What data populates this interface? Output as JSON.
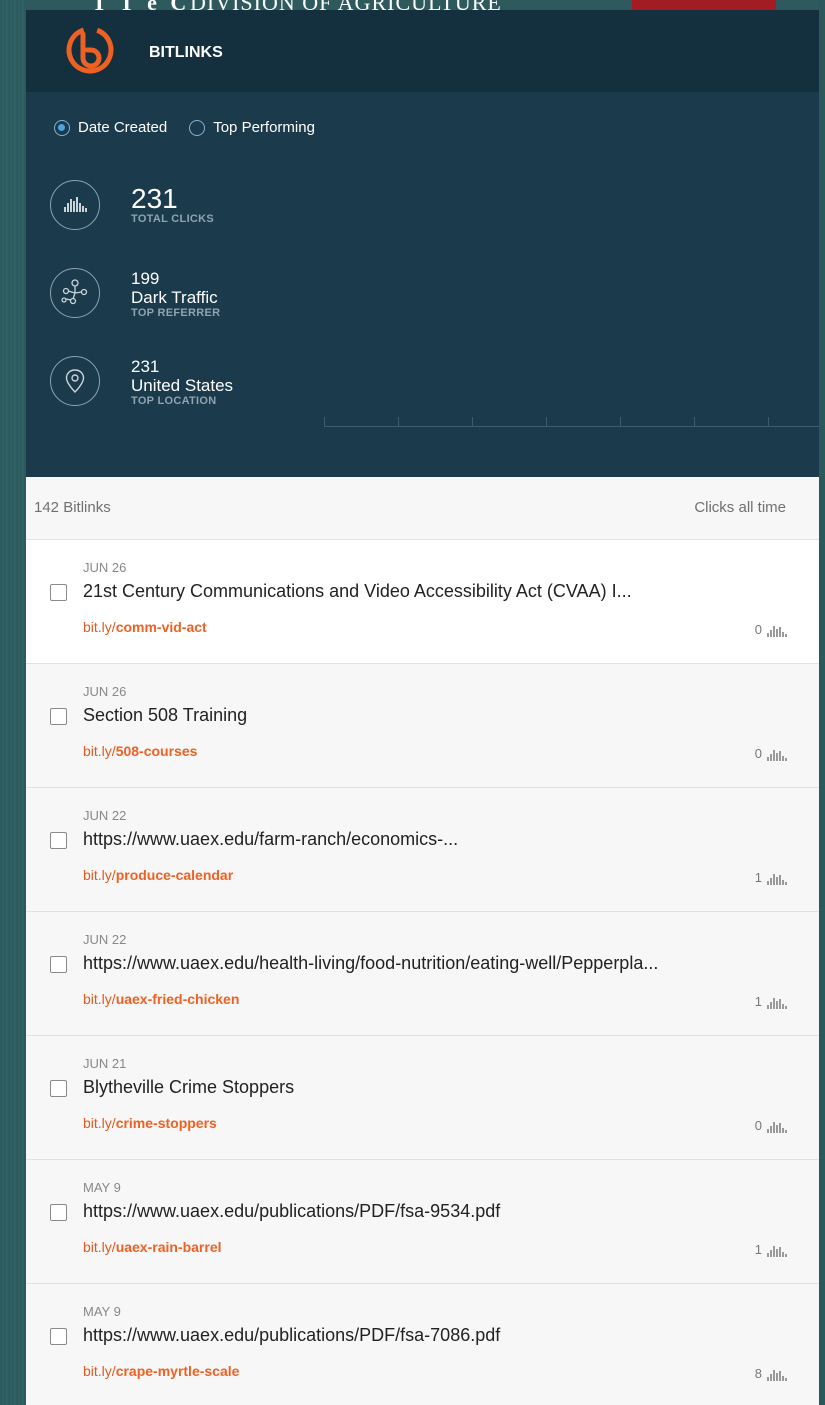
{
  "banner": {
    "mark": "T T e C",
    "text": "DIVISION OF AGRICULTURE"
  },
  "header": {
    "title": "BITLINKS",
    "logo_icon": "bitly-logo-icon",
    "brand_color": "#ee6123"
  },
  "filters": {
    "options": [
      {
        "label": "Date Created",
        "selected": true
      },
      {
        "label": "Top Performing",
        "selected": false
      }
    ]
  },
  "stats": {
    "total": {
      "value": "231",
      "caption": "TOTAL CLICKS",
      "icon": "bar-chart-icon"
    },
    "referrer": {
      "value": "199",
      "name": "Dark Traffic",
      "caption": "TOP REFERRER",
      "icon": "network-icon"
    },
    "location": {
      "value": "231",
      "name": "United States",
      "caption": "TOP LOCATION",
      "icon": "location-pin-icon"
    }
  },
  "list": {
    "count_label": "142 Bitlinks",
    "clicks_label": "Clicks all time",
    "items": [
      {
        "date": "JUN 26",
        "title": "21st Century Communications and Video Accessibility Act (CVAA) I...",
        "host": "bit.ly/",
        "slug": "comm-vid-act",
        "clicks": "0"
      },
      {
        "date": "JUN 26",
        "title": "Section 508 Training",
        "host": "bit.ly/",
        "slug": "508-courses",
        "clicks": "0"
      },
      {
        "date": "JUN 22",
        "title": "https://www.uaex.edu/farm-ranch/economics-...",
        "host": "bit.ly/",
        "slug": "produce-calendar",
        "clicks": "1"
      },
      {
        "date": "JUN 22",
        "title": "https://www.uaex.edu/health-living/food-nutrition/eating-well/Pepperpla...",
        "host": "bit.ly/",
        "slug": "uaex-fried-chicken",
        "clicks": "1"
      },
      {
        "date": "JUN 21",
        "title": "Blytheville Crime Stoppers",
        "host": "bit.ly/",
        "slug": "crime-stoppers",
        "clicks": "0"
      },
      {
        "date": "MAY 9",
        "title": "https://www.uaex.edu/publications/PDF/fsa-9534.pdf",
        "host": "bit.ly/",
        "slug": "uaex-rain-barrel",
        "clicks": "1"
      },
      {
        "date": "MAY 9",
        "title": "https://www.uaex.edu/publications/PDF/fsa-7086.pdf",
        "host": "bit.ly/",
        "slug": "crape-myrtle-scale",
        "clicks": "8"
      }
    ]
  }
}
